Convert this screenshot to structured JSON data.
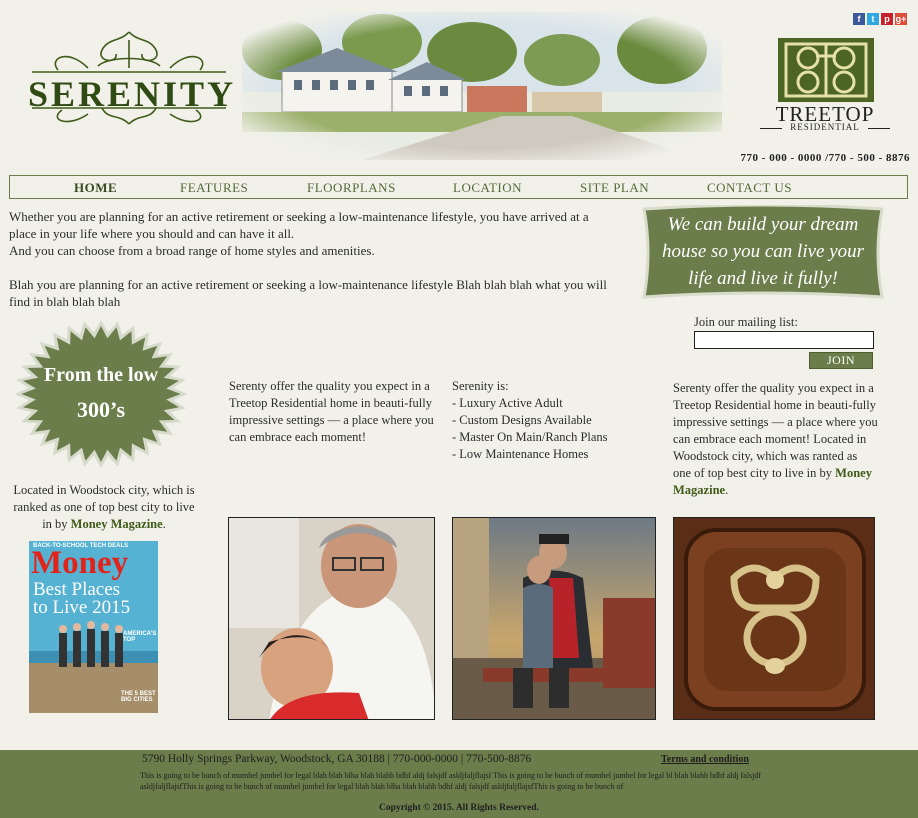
{
  "header": {
    "logo_text": "SERENITY",
    "brand_name": "TREETOP",
    "brand_sub": "RESIDENTIAL",
    "phones": "770 - 000 - 0000 /770 - 500 - 8876",
    "social": [
      {
        "icon": "facebook-icon",
        "glyph": "f",
        "color": "#3b5998"
      },
      {
        "icon": "twitter-icon",
        "glyph": "t",
        "color": "#2fa8e0"
      },
      {
        "icon": "pinterest-icon",
        "glyph": "p",
        "color": "#c8232c"
      },
      {
        "icon": "googleplus-icon",
        "glyph": "g+",
        "color": "#dd4b39"
      }
    ]
  },
  "nav": {
    "items": [
      {
        "label": "HOME",
        "active": true
      },
      {
        "label": "FEATURES",
        "active": false
      },
      {
        "label": "FLOORPLANS",
        "active": false
      },
      {
        "label": "LOCATION",
        "active": false
      },
      {
        "label": "SITE PLAN",
        "active": false
      },
      {
        "label": "CONTACT US",
        "active": false
      }
    ]
  },
  "intro": {
    "p1": "Whether you are planning for an active retirement or seeking a low-maintenance lifestyle,  you have arrived at a place in your life where you should and can have it all.",
    "p2": "And you can choose from a broad range of  home  styles and amenities.",
    "p3": "Blah you are planning for an active retirement or seeking a low-maintenance lifestyle Blah blah blah what you will find in blah blah blah"
  },
  "banner": {
    "line1": "We can build your dream",
    "line2": "house so you can live your",
    "line3": "life and live it fully!"
  },
  "mailing": {
    "label": "Join our mailing list:",
    "value": "",
    "button": "JOIN"
  },
  "starburst": {
    "line1": "From the low",
    "line2": "300’s"
  },
  "column1": {
    "text": "Serenty offer the quality you expect in a Treetop Residential home in beauti-fully impressive settings — a place where you can embrace each moment!"
  },
  "column2": {
    "heading": "Serenity is:",
    "items": [
      "- Luxury Active Adult",
      "- Custom Designs Available",
      "- Master On Main/Ranch Plans",
      "- Low Maintenance Homes"
    ]
  },
  "column3": {
    "text": "Serenty offer the quality you expect in a Treetop Residential home in beauti-fully impressive settings — a place where you can embrace each moment! Located in Woodstock city, which was ranted as one of  top best city to live in by ",
    "bold": "Money Magazine",
    "end": "."
  },
  "located": {
    "text": "Located in Woodstock city, which is ranked as one of  top best city to live in by ",
    "bold": "Money Magazine",
    "end": "."
  },
  "magazine": {
    "tag": "BACK-TO-SCHOOL TECH DEALS",
    "title": "Money",
    "headline1": "Best Places",
    "headline2": "to Live 2015",
    "side": "AMERICA'S TOP",
    "bottom": "THE 5 BEST BIG CITIES"
  },
  "footer": {
    "address": "5790 Holly Springs Parkway, Woodstock, GA 30188  |  770-000-0000  |  770-500-8876",
    "terms": "Terms and condition",
    "legal": "This is going to be bunch of  mumbel jumbel for legal blah blah blha blah blahh bdhf  aldj falsjdf  asldjfaljflajsf  This is going to be bunch of  mumbel jumbel for legal bl blah blahh bdhf  aldj falsjdf  asldjfaljflajsfThis is going to be bunch of  mumbel jumbel for legal blah blah blha blah blahh bdhf  aldj falsjdf  asldjfaljflajsfThis is going to be bunch of",
    "copyright": "Copyright © 2015. All Rights Reserved."
  },
  "colors": {
    "olive": "#6b7d4b",
    "dark_olive": "#3f5a19",
    "background": "#f1f1ea"
  }
}
